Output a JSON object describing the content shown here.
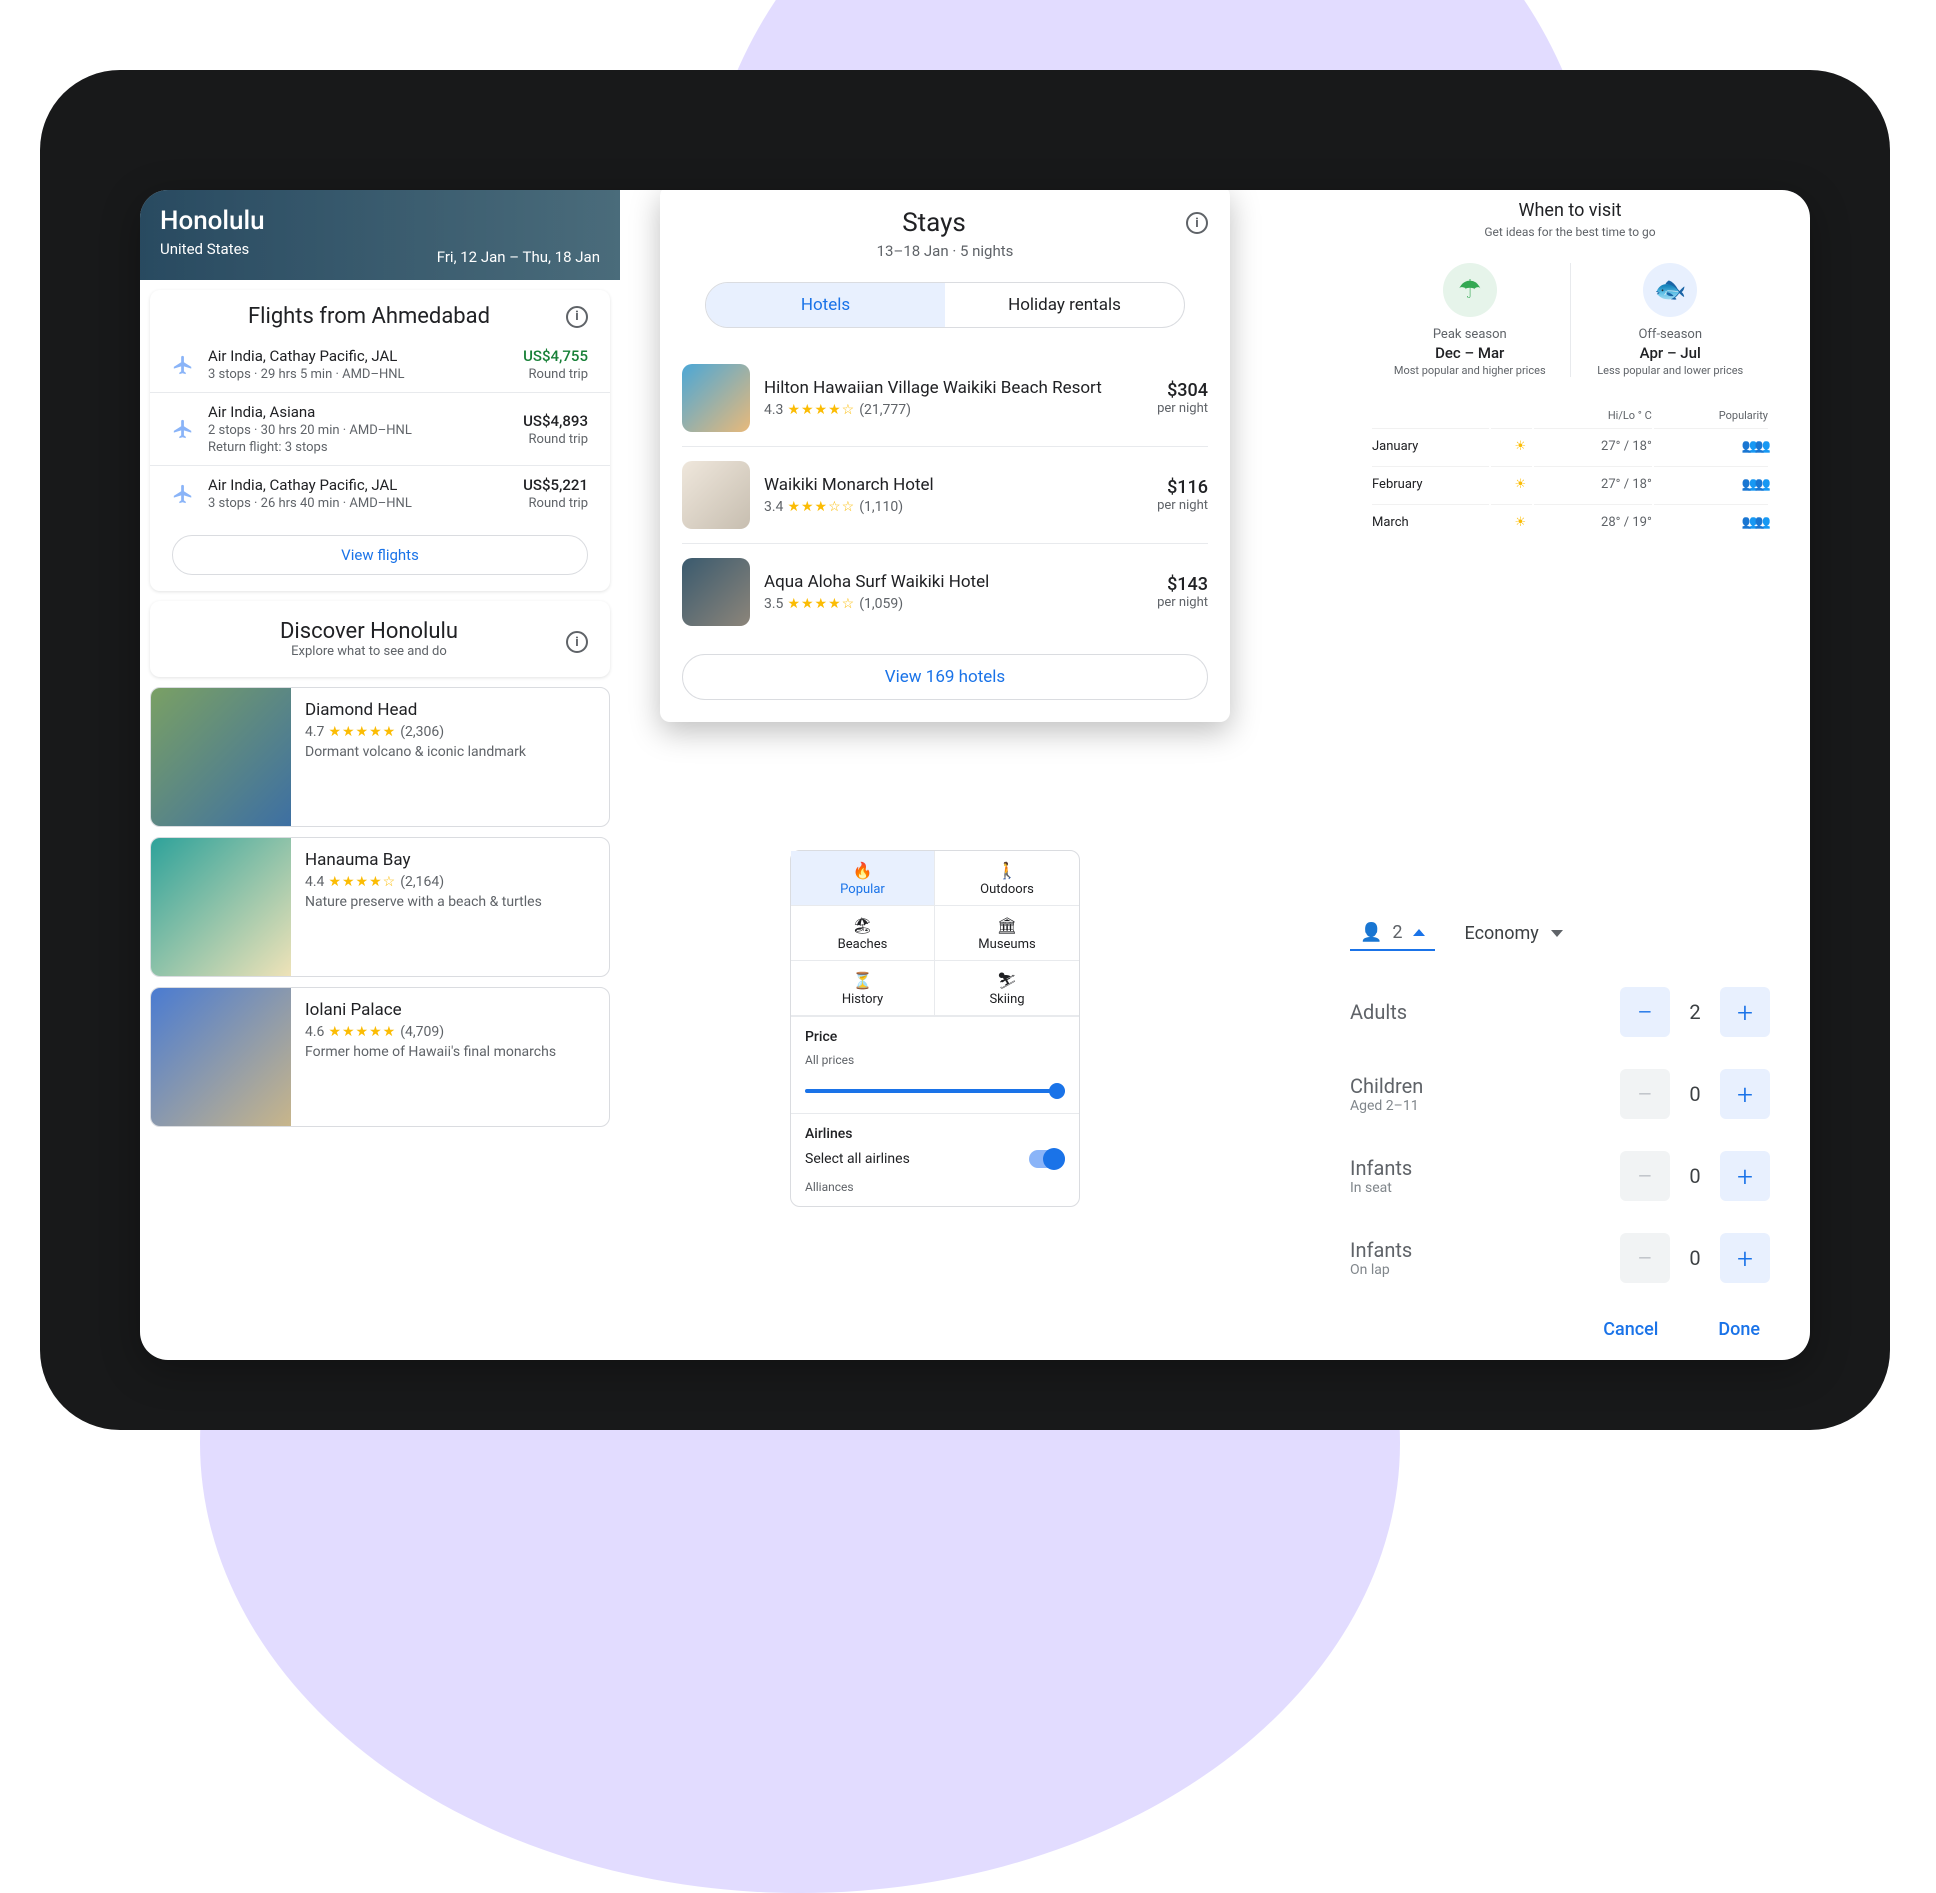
{
  "hero": {
    "city": "Honolulu",
    "country": "United States",
    "dates": "Fri, 12 Jan – Thu, 18 Jan"
  },
  "flights": {
    "title": "Flights from Ahmedabad",
    "items": [
      {
        "airlines": "Air India, Cathay Pacific, JAL",
        "meta": "3 stops · 29 hrs 5 min · AMD–HNL",
        "meta2": "",
        "price": "US$4,755",
        "green": true,
        "trip": "Round trip"
      },
      {
        "airlines": "Air India, Asiana",
        "meta": "2 stops · 30 hrs 20 min · AMD–HNL",
        "meta2": "Return flight: 3 stops",
        "price": "US$4,893",
        "green": false,
        "trip": "Round trip"
      },
      {
        "airlines": "Air India, Cathay Pacific, JAL",
        "meta": "3 stops · 26 hrs 40 min · AMD–HNL",
        "meta2": "",
        "price": "US$5,221",
        "green": false,
        "trip": "Round trip"
      }
    ],
    "cta": "View flights"
  },
  "discover": {
    "title": "Discover Honolulu",
    "sub": "Explore what to see and do",
    "items": [
      {
        "name": "Diamond Head",
        "score": "4.7",
        "stars": "★★★★★",
        "reviews": "(2,306)",
        "desc": "Dormant volcano & iconic landmark",
        "c1": "#7aa064",
        "c2": "#3d6fa3"
      },
      {
        "name": "Hanauma Bay",
        "score": "4.4",
        "stars": "★★★★☆",
        "reviews": "(2,164)",
        "desc": "Nature preserve with a beach & turtles",
        "c1": "#2ea29a",
        "c2": "#f0e3b8"
      },
      {
        "name": "Iolani Palace",
        "score": "4.6",
        "stars": "★★★★★",
        "reviews": "(4,709)",
        "desc": "Former home of Hawaii's final monarchs",
        "c1": "#4a7bd1",
        "c2": "#c9b68a"
      }
    ]
  },
  "stays": {
    "title": "Stays",
    "sub": "13–18 Jan · 5 nights",
    "tabs": {
      "hotels": "Hotels",
      "holiday": "Holiday rentals"
    },
    "items": [
      {
        "name": "Hilton Hawaiian Village Waikiki Beach Resort",
        "score": "4.3",
        "stars": "★★★★☆",
        "reviews": "(21,777)",
        "price": "$304",
        "unit": "per night",
        "c1": "#4ba7d6",
        "c2": "#e8b97a"
      },
      {
        "name": "Waikiki Monarch Hotel",
        "score": "3.4",
        "stars": "★★★☆☆",
        "reviews": "(1,110)",
        "price": "$116",
        "unit": "per night",
        "c1": "#efe7dc",
        "c2": "#c7beb0"
      },
      {
        "name": "Aqua Aloha Surf Waikiki Hotel",
        "score": "3.5",
        "stars": "★★★★☆",
        "reviews": "(1,059)",
        "price": "$143",
        "unit": "per night",
        "c1": "#3a5a6e",
        "c2": "#8c857a"
      }
    ],
    "cta": "View 169 hotels"
  },
  "filters": {
    "cats": [
      {
        "label": "Popular",
        "icon": "🔥",
        "active": true
      },
      {
        "label": "Outdoors",
        "icon": "🚶",
        "active": false
      },
      {
        "label": "Beaches",
        "icon": "🏖",
        "active": false
      },
      {
        "label": "Museums",
        "icon": "🏛",
        "active": false
      },
      {
        "label": "History",
        "icon": "⏳",
        "active": false
      },
      {
        "label": "Skiing",
        "icon": "⛷",
        "active": false
      }
    ],
    "price": {
      "label": "Price",
      "sub": "All prices"
    },
    "airlines": {
      "label": "Airlines",
      "selectAll": "Select all airlines",
      "alliances": "Alliances"
    }
  },
  "when": {
    "title": "When to visit",
    "sub": "Get ideas for the best time to go",
    "peak": {
      "label": "Peak season",
      "range": "Dec – Mar",
      "desc": "Most popular and higher prices"
    },
    "off": {
      "label": "Off-season",
      "range": "Apr – Jul",
      "desc": "Less popular and lower prices"
    },
    "headers": {
      "temp": "Hi/Lo ° C",
      "pop": "Popularity"
    },
    "rows": [
      {
        "month": "January",
        "temp": "27° / 18°"
      },
      {
        "month": "February",
        "temp": "27° / 18°"
      },
      {
        "month": "March",
        "temp": "28° / 19°"
      }
    ]
  },
  "pax": {
    "count": "2",
    "cabin": "Economy",
    "rows": [
      {
        "label": "Adults",
        "sub": "",
        "val": "2",
        "minusBlue": true
      },
      {
        "label": "Children",
        "sub": "Aged 2–11",
        "val": "0",
        "minusBlue": false
      },
      {
        "label": "Infants",
        "sub": "In seat",
        "val": "0",
        "minusBlue": false
      },
      {
        "label": "Infants",
        "sub": "On lap",
        "val": "0",
        "minusBlue": false
      }
    ],
    "cancel": "Cancel",
    "done": "Done"
  }
}
